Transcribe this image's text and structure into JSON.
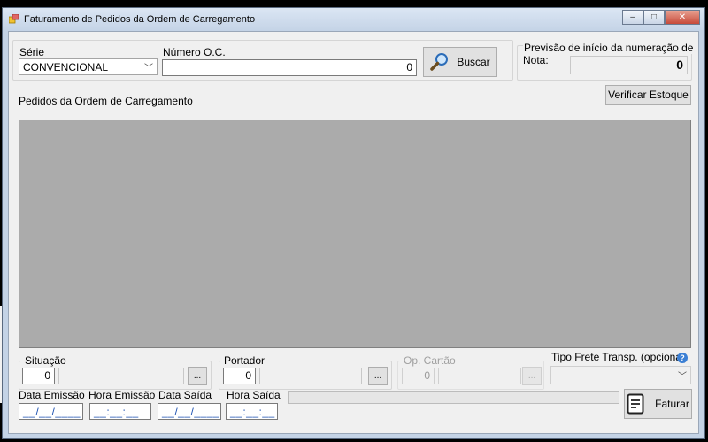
{
  "window": {
    "title": "Faturamento de Pedidos da Ordem de Carregamento",
    "controls": {
      "minimize": "‒",
      "maximize": "□",
      "close": "✕"
    }
  },
  "serie": {
    "label": "Série",
    "selected": "CONVENCIONAL"
  },
  "numero_oc": {
    "label": "Número O.C.",
    "value": "0"
  },
  "buscar": {
    "label": "Buscar"
  },
  "previsao": {
    "label_line1": "Previsão de início da numeração de",
    "label_line2": "Nota:",
    "value": "0"
  },
  "verificar_estoque": {
    "label": "Verificar Estoque"
  },
  "pedidos": {
    "label": "Pedidos da Ordem de Carregamento"
  },
  "situacao": {
    "label": "Situação",
    "code": "0",
    "browse": "..."
  },
  "portador": {
    "label": "Portador",
    "code": "0",
    "browse": "..."
  },
  "op_cartao": {
    "label": "Op. Cartão",
    "code": "0",
    "browse": "..."
  },
  "tipo_frete": {
    "label": "Tipo Frete Transp. (opcional)",
    "help": "?"
  },
  "data_emissao": {
    "label": "Data Emissão",
    "value": "__/__/____"
  },
  "hora_emissao": {
    "label": "Hora Emissão",
    "value": "__:__:__"
  },
  "data_saida": {
    "label": "Data Saída",
    "value": "__/__/____"
  },
  "hora_saida": {
    "label": "Hora Saída",
    "value": "__:__:__"
  },
  "faturar": {
    "label": "Faturar"
  },
  "colors": {
    "grid": "#ababab",
    "accent": "#3b7fd4",
    "mask_text": "#1a4fb0"
  }
}
